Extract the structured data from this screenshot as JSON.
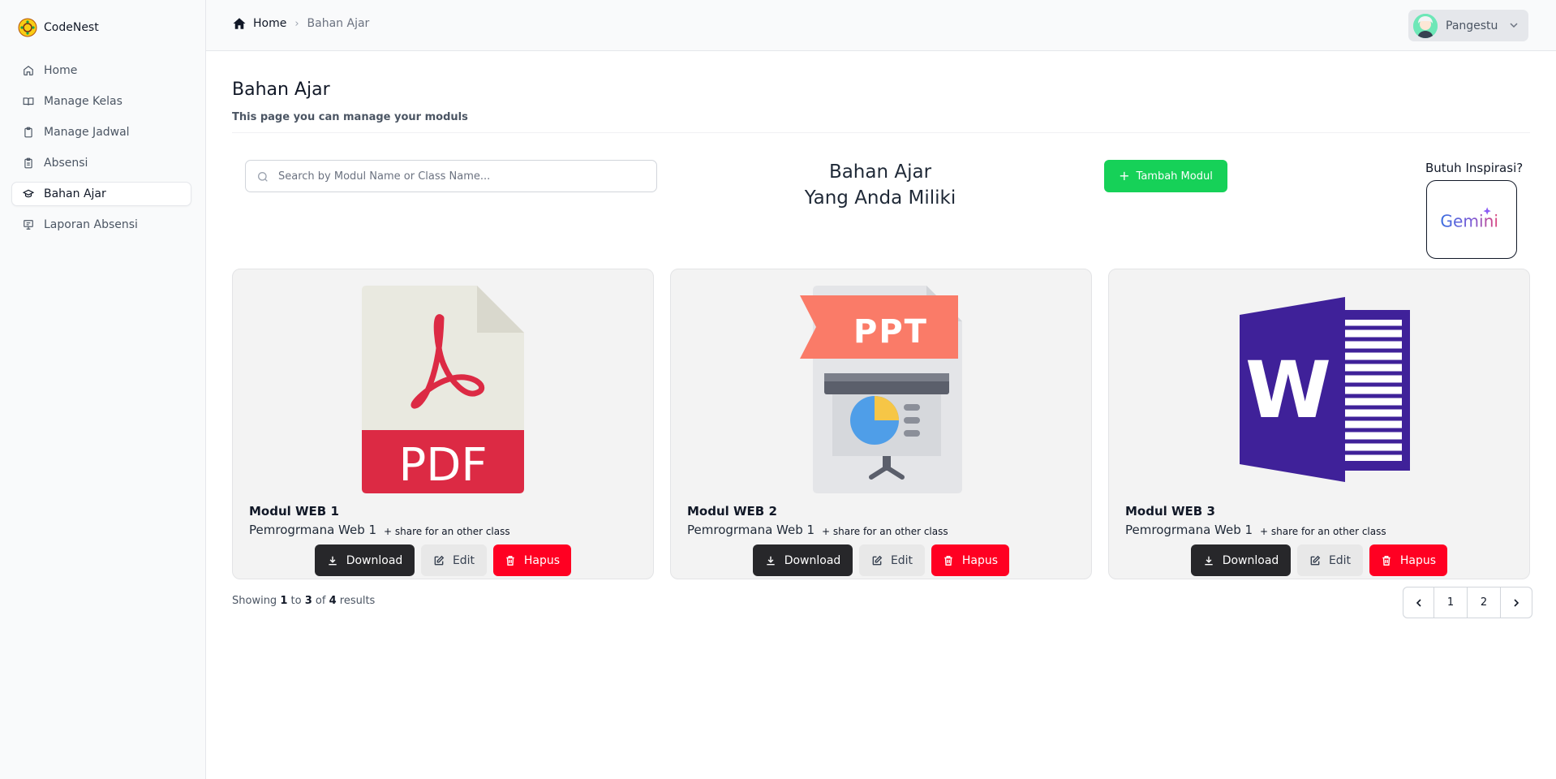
{
  "app": {
    "name": "CodeNest"
  },
  "sidebar": {
    "items": [
      {
        "label": "Home",
        "icon": "home-icon"
      },
      {
        "label": "Manage Kelas",
        "icon": "book-open-icon"
      },
      {
        "label": "Manage Jadwal",
        "icon": "clipboard-icon"
      },
      {
        "label": "Absensi",
        "icon": "clipboard-list-icon"
      },
      {
        "label": "Bahan Ajar",
        "icon": "graduation-cap-icon",
        "active": true
      },
      {
        "label": "Laporan Absensi",
        "icon": "presentation-board-icon"
      }
    ]
  },
  "breadcrumb": {
    "home": "Home",
    "current": "Bahan Ajar"
  },
  "user": {
    "name": "Pangestu"
  },
  "page": {
    "title": "Bahan Ajar",
    "subtitle": "This page you can manage your moduls"
  },
  "search": {
    "placeholder": "Search by Modul Name or Class Name..."
  },
  "heading": {
    "line1": "Bahan Ajar",
    "line2": "Yang Anda Miliki"
  },
  "add_button": {
    "label": "Tambah Modul"
  },
  "inspiration": {
    "label": "Butuh Inspirasi?",
    "logo_text": "Gemini"
  },
  "cards": [
    {
      "title": "Modul WEB 1",
      "class_name": "Pemrogrmana Web 1",
      "share": "+ share for an other class",
      "file_type": "PDF",
      "icon": "pdf-file-icon"
    },
    {
      "title": "Modul WEB 2",
      "class_name": "Pemrogrmana Web 1",
      "share": "+ share for an other class",
      "file_type": "PPT",
      "icon": "ppt-file-icon"
    },
    {
      "title": "Modul WEB 3",
      "class_name": "Pemrogrmana Web 1",
      "share": "+ share for an other class",
      "file_type": "W",
      "icon": "word-file-icon"
    }
  ],
  "card_buttons": {
    "download": "Download",
    "edit": "Edit",
    "delete": "Hapus"
  },
  "pagination": {
    "prefix": "Showing",
    "from": "1",
    "to_word": "to",
    "to": "3",
    "of_word": "of",
    "total": "4",
    "suffix": "results",
    "pages": [
      "1",
      "2"
    ]
  },
  "colors": {
    "add_button": "#16d158",
    "delete_button": "#ff0022",
    "download_button": "#27272a",
    "pdf_red": "#dc2a44",
    "word_purple": "#3f2199",
    "ppt_salmon": "#fa7b68"
  }
}
